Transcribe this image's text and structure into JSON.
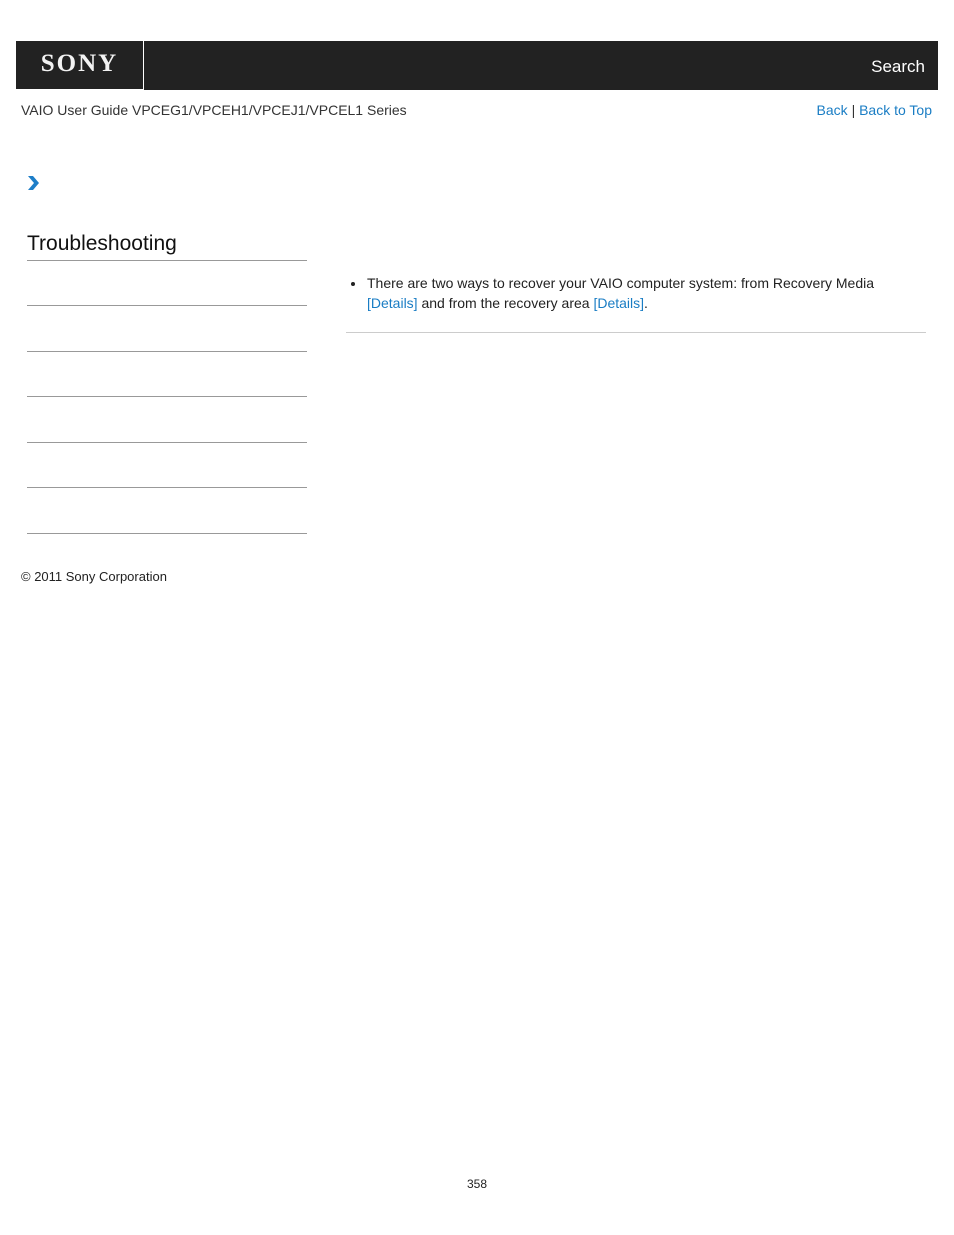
{
  "header": {
    "logo_text": "SONY",
    "search_label": "Search",
    "colors": {
      "bar": "#222222",
      "link": "#1a7dc4"
    }
  },
  "subheader": {
    "guide_title": "VAIO User Guide VPCEG1/VPCEH1/VPCEJ1/VPCEL1 Series",
    "back_label": "Back",
    "separator": "|",
    "back_to_top_label": "Back to Top"
  },
  "breadcrumb": {
    "icon": "chevron-right-icon"
  },
  "sidebar": {
    "section_title": "Troubleshooting",
    "item_count": 6
  },
  "content": {
    "bullets": [
      {
        "text_before": "There are two ways to recover your VAIO computer system: from Recovery Media ",
        "link1": "[Details]",
        "text_middle": " and from the recovery area ",
        "link2": "[Details]",
        "text_after": "."
      }
    ]
  },
  "footer": {
    "copyright": "© 2011 Sony Corporation",
    "page_number": "358"
  }
}
